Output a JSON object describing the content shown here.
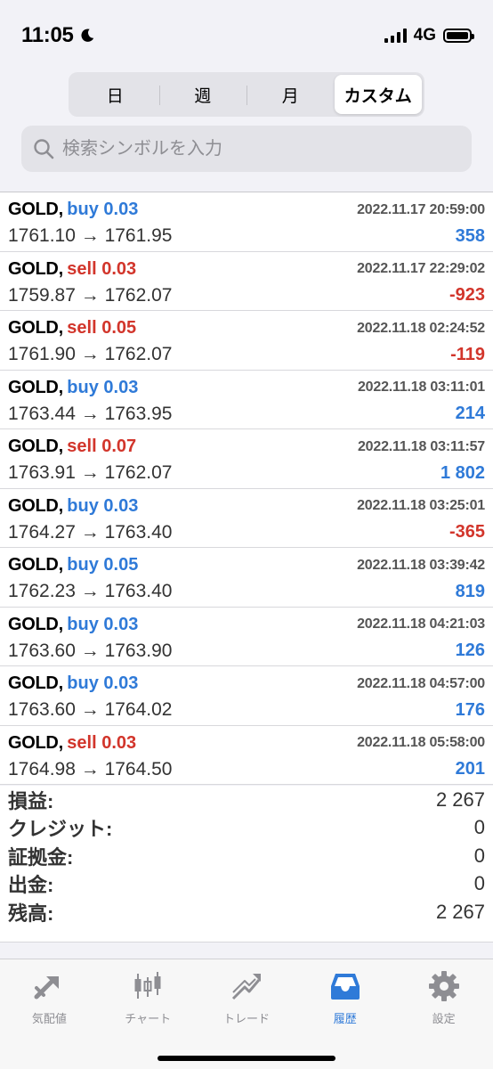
{
  "status_bar": {
    "time": "11:05",
    "network": "4G"
  },
  "segments": [
    {
      "label": "日",
      "active": false
    },
    {
      "label": "週",
      "active": false
    },
    {
      "label": "月",
      "active": false
    },
    {
      "label": "カスタム",
      "active": true
    }
  ],
  "search": {
    "placeholder": "検索シンボルを入力",
    "value": ""
  },
  "trades": [
    {
      "symbol": "GOLD,",
      "direction": "buy",
      "direction_text": "buy 0.03",
      "timestamp": "2022.11.17 20:59:00",
      "prices": "1761.10 → 1761.95",
      "profit": "358",
      "profit_sign": "pos"
    },
    {
      "symbol": "GOLD,",
      "direction": "sell",
      "direction_text": "sell 0.03",
      "timestamp": "2022.11.17 22:29:02",
      "prices": "1759.87 → 1762.07",
      "profit": "-923",
      "profit_sign": "neg"
    },
    {
      "symbol": "GOLD,",
      "direction": "sell",
      "direction_text": "sell 0.05",
      "timestamp": "2022.11.18 02:24:52",
      "prices": "1761.90 → 1762.07",
      "profit": "-119",
      "profit_sign": "neg"
    },
    {
      "symbol": "GOLD,",
      "direction": "buy",
      "direction_text": "buy 0.03",
      "timestamp": "2022.11.18 03:11:01",
      "prices": "1763.44 → 1763.95",
      "profit": "214",
      "profit_sign": "pos"
    },
    {
      "symbol": "GOLD,",
      "direction": "sell",
      "direction_text": "sell 0.07",
      "timestamp": "2022.11.18 03:11:57",
      "prices": "1763.91 → 1762.07",
      "profit": "1 802",
      "profit_sign": "pos"
    },
    {
      "symbol": "GOLD,",
      "direction": "buy",
      "direction_text": "buy 0.03",
      "timestamp": "2022.11.18 03:25:01",
      "prices": "1764.27 → 1763.40",
      "profit": "-365",
      "profit_sign": "neg"
    },
    {
      "symbol": "GOLD,",
      "direction": "buy",
      "direction_text": "buy 0.05",
      "timestamp": "2022.11.18 03:39:42",
      "prices": "1762.23 → 1763.40",
      "profit": "819",
      "profit_sign": "pos"
    },
    {
      "symbol": "GOLD,",
      "direction": "buy",
      "direction_text": "buy 0.03",
      "timestamp": "2022.11.18 04:21:03",
      "prices": "1763.60 → 1763.90",
      "profit": "126",
      "profit_sign": "pos"
    },
    {
      "symbol": "GOLD,",
      "direction": "buy",
      "direction_text": "buy 0.03",
      "timestamp": "2022.11.18 04:57:00",
      "prices": "1763.60 → 1764.02",
      "profit": "176",
      "profit_sign": "pos"
    },
    {
      "symbol": "GOLD,",
      "direction": "sell",
      "direction_text": "sell 0.03",
      "timestamp": "2022.11.18 05:58:00",
      "prices": "1764.98 → 1764.50",
      "profit": "201",
      "profit_sign": "pos"
    }
  ],
  "summary": [
    {
      "label": "損益:",
      "value": "2 267"
    },
    {
      "label": "クレジット:",
      "value": "0"
    },
    {
      "label": "証拠金:",
      "value": "0"
    },
    {
      "label": "出金:",
      "value": "0"
    },
    {
      "label": "残高:",
      "value": "2 267"
    }
  ],
  "tabs": [
    {
      "label": "気配値",
      "icon": "quotes-icon",
      "active": false
    },
    {
      "label": "チャート",
      "icon": "chart-candles-icon",
      "active": false
    },
    {
      "label": "トレード",
      "icon": "trade-icon",
      "active": false
    },
    {
      "label": "履歴",
      "icon": "history-inbox-icon",
      "active": true
    },
    {
      "label": "設定",
      "icon": "gear-icon",
      "active": false
    }
  ],
  "colors": {
    "buy": "#2f7ad8",
    "sell": "#d2352b",
    "accent": "#2f7ad8",
    "inactive": "#8e8e93"
  }
}
